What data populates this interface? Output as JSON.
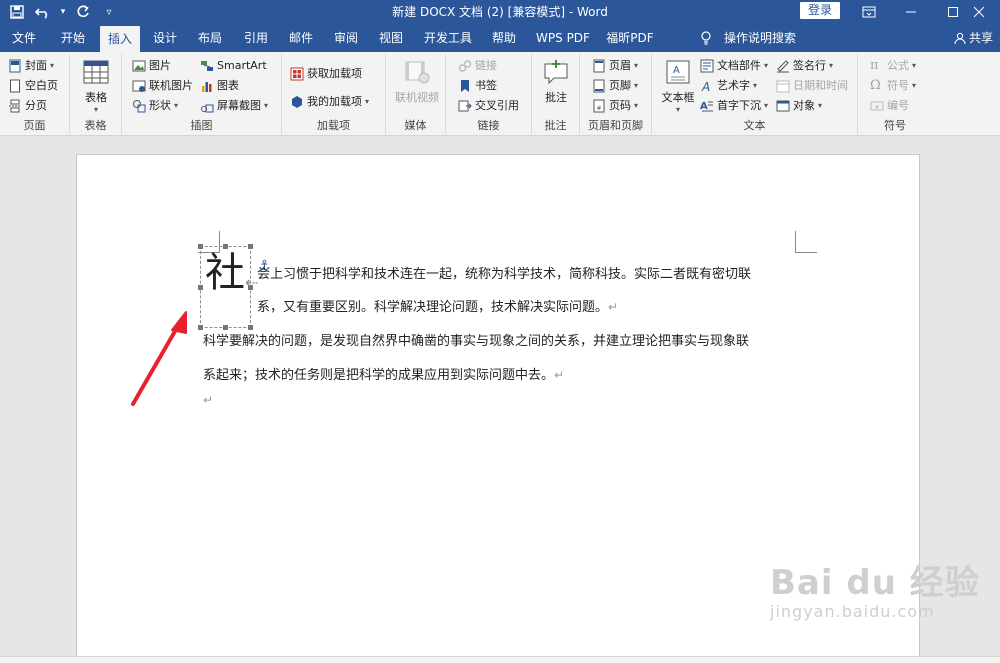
{
  "titlebar": {
    "title": "新建 DOCX 文档 (2) [兼容模式] - Word",
    "login": "登录",
    "qat": {
      "save_icon": "save-icon",
      "undo_icon": "undo-icon",
      "redo_icon": "redo-icon",
      "customize_icon": "customize-icon"
    }
  },
  "tabs": [
    {
      "label": "文件"
    },
    {
      "label": "开始"
    },
    {
      "label": "插入"
    },
    {
      "label": "设计"
    },
    {
      "label": "布局"
    },
    {
      "label": "引用"
    },
    {
      "label": "邮件"
    },
    {
      "label": "审阅"
    },
    {
      "label": "视图"
    },
    {
      "label": "开发工具"
    },
    {
      "label": "帮助"
    },
    {
      "label": "WPS PDF"
    },
    {
      "label": "福昕PDF"
    }
  ],
  "search_tab": "操作说明搜索",
  "share": "共享",
  "ribbon": {
    "pages": {
      "label": "页面",
      "cover": "封面",
      "blank": "空白页",
      "break": "分页"
    },
    "tables": {
      "label": "表格",
      "table": "表格"
    },
    "illustrations": {
      "label": "插图",
      "picture": "图片",
      "online_picture": "联机图片",
      "shapes": "形状",
      "smartart": "SmartArt",
      "chart": "图表",
      "screenshot": "屏幕截图"
    },
    "addins": {
      "label": "加载项",
      "get": "获取加载项",
      "my": "我的加载项"
    },
    "media": {
      "label": "媒体",
      "online_video": "联机视频"
    },
    "links": {
      "label": "链接",
      "link": "链接",
      "bookmark": "书签",
      "cross_ref": "交叉引用"
    },
    "comments": {
      "label": "批注",
      "comment": "批注"
    },
    "header_footer": {
      "label": "页眉和页脚",
      "header": "页眉",
      "footer": "页脚",
      "page_number": "页码"
    },
    "text": {
      "label": "文本",
      "textbox": "文本框",
      "quick_parts": "文档部件",
      "wordart": "艺术字",
      "dropcap": "首字下沉",
      "signature": "签名行",
      "datetime": "日期和时间",
      "object": "对象"
    },
    "symbols": {
      "label": "符号",
      "equation": "公式",
      "symbol": "符号",
      "number": "编号"
    }
  },
  "document": {
    "dropcap": "社",
    "line1": "会上习惯于把科学和技术连在一起，统称为科学技术，简称科技。实际二者既有密切联",
    "line2": "系，又有重要区别。科学解决理论问题，技术解决实际问题。",
    "line3": "科学要解决的问题，是发现自然界中确凿的事实与现象之间的关系，并建立理论把事实与现象联",
    "line4": "系起来；技术的任务则是把科学的成果应用到实际问题中去。",
    "para_mark": "↵"
  },
  "watermark": {
    "brand": "Bai du 经验",
    "url": "jingyan.baidu.com"
  },
  "colors": {
    "accent": "#2b579a",
    "arrow": "#e8222c"
  }
}
